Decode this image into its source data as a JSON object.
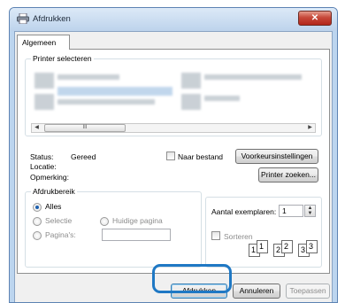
{
  "window": {
    "title": "Afdrukken",
    "close_symbol": "✕"
  },
  "tabs": [
    {
      "label": "Algemeen"
    }
  ],
  "printer_group": {
    "title": "Printer selecteren",
    "scroll_left": "◀",
    "scroll_right": "▶",
    "scroll_thumb": "III"
  },
  "status": {
    "status_label": "Status:",
    "status_value": "Gereed",
    "location_label": "Locatie:",
    "comment_label": "Opmerking:",
    "print_to_file_label": "Naar bestand",
    "preferences_button": "Voorkeursinstellingen",
    "find_printer_button": "Printer zoeken..."
  },
  "range_group": {
    "title": "Afdrukbereik",
    "options": [
      {
        "label": "Alles",
        "selected": true
      },
      {
        "label": "Selectie",
        "selected": false
      },
      {
        "label": "Huidige pagina",
        "selected": false
      },
      {
        "label": "Pagina's:",
        "selected": false
      }
    ]
  },
  "copies": {
    "label": "Aantal exemplaren:",
    "value": "1",
    "collate_label": "Sorteren",
    "spin_up": "▲",
    "spin_down": "▼",
    "collate_pages": [
      "1",
      "1",
      "2",
      "2",
      "3",
      "3"
    ]
  },
  "footer": {
    "print_button": "Afdrukken",
    "cancel_button": "Annuleren",
    "apply_button": "Toepassen"
  },
  "colors": {
    "accent": "#1f78c4",
    "titlebar": "#bdd3ec",
    "close_button": "#c7493a"
  }
}
